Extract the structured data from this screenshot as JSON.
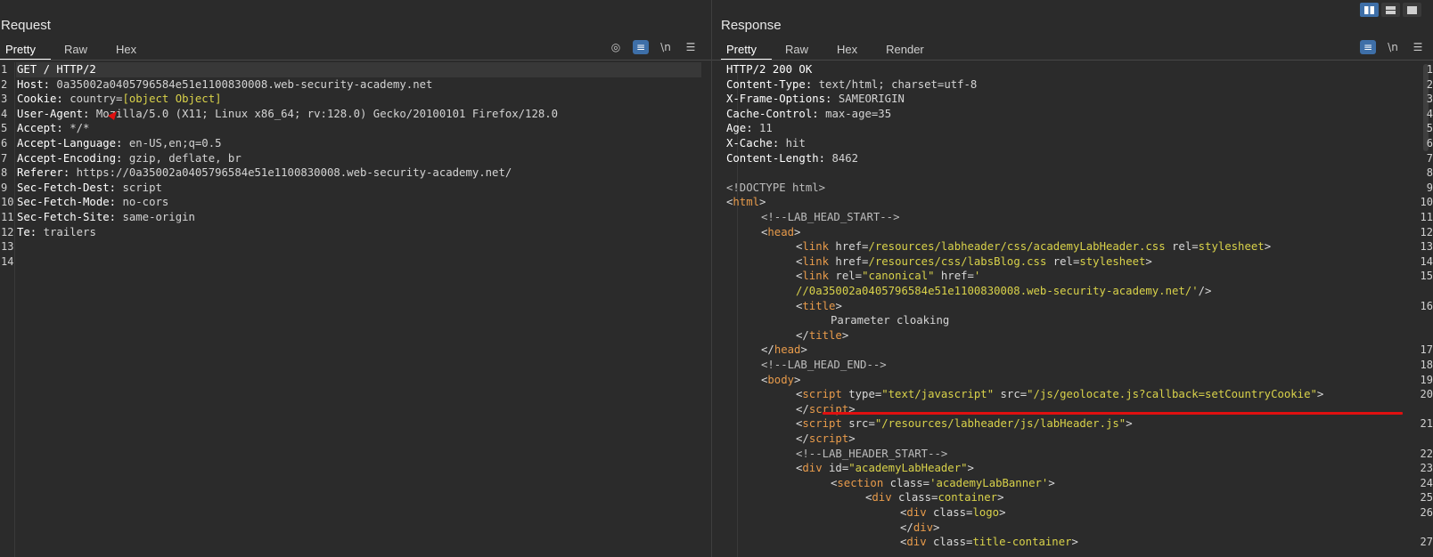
{
  "request": {
    "title": "Request",
    "tabs": [
      "Pretty",
      "Raw",
      "Hex"
    ],
    "tools": [
      {
        "name": "eye-off-icon",
        "glyph": "◎",
        "on": false
      },
      {
        "name": "wrap-lines-icon",
        "glyph": "≡",
        "on": true
      },
      {
        "name": "newline-toggle",
        "glyph": "\\n",
        "on": false
      },
      {
        "name": "menu-icon",
        "glyph": "☰",
        "on": false
      }
    ],
    "lines": [
      [
        [
          "k",
          "GET / HTTP/2"
        ]
      ],
      [
        [
          "k",
          "Host: "
        ],
        [
          "v",
          "0a35002a0405796584e51e1100830008.web-security-academy.net"
        ]
      ],
      [
        [
          "k",
          "Cookie: "
        ],
        [
          "v",
          "country="
        ],
        [
          "y",
          "[object Object]"
        ]
      ],
      [
        [
          "k",
          "User-Agent: "
        ],
        [
          "v",
          "Mozilla/5.0 (X11; Linux x86_64; rv:128.0) Gecko/20100101 Firefox/128.0"
        ]
      ],
      [
        [
          "k",
          "Accept: "
        ],
        [
          "v",
          "*/*"
        ]
      ],
      [
        [
          "k",
          "Accept-Language: "
        ],
        [
          "v",
          "en-US,en;q=0.5"
        ]
      ],
      [
        [
          "k",
          "Accept-Encoding: "
        ],
        [
          "v",
          "gzip, deflate, br"
        ]
      ],
      [
        [
          "k",
          "Referer: "
        ],
        [
          "v",
          "https://0a35002a0405796584e51e1100830008.web-security-academy.net/"
        ]
      ],
      [
        [
          "k",
          "Sec-Fetch-Dest: "
        ],
        [
          "v",
          "script"
        ]
      ],
      [
        [
          "k",
          "Sec-Fetch-Mode: "
        ],
        [
          "v",
          "no-cors"
        ]
      ],
      [
        [
          "k",
          "Sec-Fetch-Site: "
        ],
        [
          "v",
          "same-origin"
        ]
      ],
      [
        [
          "k",
          "Te: "
        ],
        [
          "v",
          "trailers"
        ]
      ],
      [],
      []
    ],
    "line_numbers": [
      "1",
      "2",
      "3",
      "4",
      "5",
      "6",
      "7",
      "8",
      "9",
      "10",
      "11",
      "12",
      "13",
      "14"
    ]
  },
  "response": {
    "title": "Response",
    "tabs": [
      "Pretty",
      "Raw",
      "Hex",
      "Render"
    ],
    "tools": [
      {
        "name": "wrap-lines-icon",
        "glyph": "≡",
        "on": true
      },
      {
        "name": "newline-toggle",
        "glyph": "\\n",
        "on": false
      },
      {
        "name": "menu-icon",
        "glyph": "☰",
        "on": false
      }
    ],
    "rows": [
      {
        "n": "1",
        "i": 0,
        "s": [
          [
            "k",
            "HTTP/2 200 OK"
          ]
        ]
      },
      {
        "n": "2",
        "i": 0,
        "s": [
          [
            "k",
            "Content-Type: "
          ],
          [
            "v",
            "text/html; charset=utf-8"
          ]
        ]
      },
      {
        "n": "3",
        "i": 0,
        "s": [
          [
            "k",
            "X-Frame-Options: "
          ],
          [
            "v",
            "SAMEORIGIN"
          ]
        ]
      },
      {
        "n": "4",
        "i": 0,
        "s": [
          [
            "k",
            "Cache-Control: "
          ],
          [
            "v",
            "max-age=35"
          ]
        ]
      },
      {
        "n": "5",
        "i": 0,
        "s": [
          [
            "k",
            "Age: "
          ],
          [
            "v",
            "11"
          ]
        ]
      },
      {
        "n": "6",
        "i": 0,
        "s": [
          [
            "k",
            "X-Cache: "
          ],
          [
            "v",
            "hit"
          ]
        ]
      },
      {
        "n": "7",
        "i": 0,
        "s": [
          [
            "k",
            "Content-Length: "
          ],
          [
            "v",
            "8462"
          ]
        ]
      },
      {
        "n": "8",
        "i": 0,
        "s": []
      },
      {
        "n": "9",
        "i": 0,
        "s": [
          [
            "c",
            "<!DOCTYPE html>"
          ]
        ]
      },
      {
        "n": "10",
        "i": 0,
        "s": [
          [
            "a",
            "<"
          ],
          [
            "t",
            "html"
          ],
          [
            "a",
            ">"
          ]
        ]
      },
      {
        "n": "11",
        "i": 1,
        "s": [
          [
            "c",
            "<!--LAB_HEAD_START-->"
          ]
        ]
      },
      {
        "n": "12",
        "i": 1,
        "s": [
          [
            "a",
            "<"
          ],
          [
            "t",
            "head"
          ],
          [
            "a",
            ">"
          ]
        ]
      },
      {
        "n": "13",
        "i": 2,
        "s": [
          [
            "a",
            "<"
          ],
          [
            "t",
            "link"
          ],
          [
            "a",
            " href="
          ],
          [
            "s",
            "/resources/labheader/css/academyLabHeader.css"
          ],
          [
            "a",
            " rel="
          ],
          [
            "s",
            "stylesheet"
          ],
          [
            "a",
            ">"
          ]
        ]
      },
      {
        "n": "14",
        "i": 2,
        "s": [
          [
            "a",
            "<"
          ],
          [
            "t",
            "link"
          ],
          [
            "a",
            " href="
          ],
          [
            "s",
            "/resources/css/labsBlog.css"
          ],
          [
            "a",
            " rel="
          ],
          [
            "s",
            "stylesheet"
          ],
          [
            "a",
            ">"
          ]
        ]
      },
      {
        "n": "15",
        "i": 2,
        "s": [
          [
            "a",
            "<"
          ],
          [
            "t",
            "link"
          ],
          [
            "a",
            " rel="
          ],
          [
            "s",
            "\"canonical\""
          ],
          [
            "a",
            " href="
          ],
          [
            "s",
            "'"
          ]
        ]
      },
      {
        "n": "",
        "i": 2,
        "s": [
          [
            "s",
            "//0a35002a0405796584e51e1100830008.web-security-academy.net/'"
          ],
          [
            "a",
            "/>"
          ]
        ]
      },
      {
        "n": "16",
        "i": 2,
        "s": [
          [
            "a",
            "<"
          ],
          [
            "t",
            "title"
          ],
          [
            "a",
            ">"
          ]
        ]
      },
      {
        "n": "",
        "i": 3,
        "s": [
          [
            "v",
            "Parameter cloaking"
          ]
        ]
      },
      {
        "n": "",
        "i": 2,
        "s": [
          [
            "a",
            "</"
          ],
          [
            "t",
            "title"
          ],
          [
            "a",
            ">"
          ]
        ]
      },
      {
        "n": "17",
        "i": 1,
        "s": [
          [
            "a",
            "</"
          ],
          [
            "t",
            "head"
          ],
          [
            "a",
            ">"
          ]
        ]
      },
      {
        "n": "18",
        "i": 1,
        "s": [
          [
            "c",
            "<!--LAB_HEAD_END-->"
          ]
        ]
      },
      {
        "n": "19",
        "i": 1,
        "s": [
          [
            "a",
            "<"
          ],
          [
            "t",
            "body"
          ],
          [
            "a",
            ">"
          ]
        ]
      },
      {
        "n": "20",
        "i": 2,
        "s": [
          [
            "a",
            "<"
          ],
          [
            "t",
            "script"
          ],
          [
            "a",
            " type="
          ],
          [
            "s",
            "\"text/javascript\""
          ],
          [
            "a",
            " src="
          ],
          [
            "s",
            "\"/js/geolocate.js?callback=setCountryCookie\""
          ],
          [
            "a",
            ">"
          ]
        ]
      },
      {
        "n": "",
        "i": 2,
        "s": [
          [
            "a",
            "</"
          ],
          [
            "t",
            "script"
          ],
          [
            "a",
            ">"
          ]
        ]
      },
      {
        "n": "21",
        "i": 2,
        "s": [
          [
            "a",
            "<"
          ],
          [
            "t",
            "script"
          ],
          [
            "a",
            " src="
          ],
          [
            "s",
            "\"/resources/labheader/js/labHeader.js\""
          ],
          [
            "a",
            ">"
          ]
        ]
      },
      {
        "n": "",
        "i": 2,
        "s": [
          [
            "a",
            "</"
          ],
          [
            "t",
            "script"
          ],
          [
            "a",
            ">"
          ]
        ]
      },
      {
        "n": "22",
        "i": 2,
        "s": [
          [
            "c",
            "<!--LAB_HEADER_START-->"
          ]
        ]
      },
      {
        "n": "23",
        "i": 2,
        "s": [
          [
            "a",
            "<"
          ],
          [
            "t",
            "div"
          ],
          [
            "a",
            " id="
          ],
          [
            "s",
            "\"academyLabHeader\""
          ],
          [
            "a",
            ">"
          ]
        ]
      },
      {
        "n": "24",
        "i": 3,
        "s": [
          [
            "a",
            "<"
          ],
          [
            "t",
            "section"
          ],
          [
            "a",
            " class="
          ],
          [
            "s",
            "'academyLabBanner'"
          ],
          [
            "a",
            ">"
          ]
        ]
      },
      {
        "n": "25",
        "i": 4,
        "s": [
          [
            "a",
            "<"
          ],
          [
            "t",
            "div"
          ],
          [
            "a",
            " class="
          ],
          [
            "s",
            "container"
          ],
          [
            "a",
            ">"
          ]
        ]
      },
      {
        "n": "26",
        "i": 5,
        "s": [
          [
            "a",
            "<"
          ],
          [
            "t",
            "div"
          ],
          [
            "a",
            " class="
          ],
          [
            "s",
            "logo"
          ],
          [
            "a",
            ">"
          ]
        ]
      },
      {
        "n": "",
        "i": 5,
        "s": [
          [
            "a",
            "</"
          ],
          [
            "t",
            "div"
          ],
          [
            "a",
            ">"
          ]
        ]
      },
      {
        "n": "27",
        "i": 5,
        "s": [
          [
            "a",
            "<"
          ],
          [
            "t",
            "div"
          ],
          [
            "a",
            " class="
          ],
          [
            "s",
            "title-container"
          ],
          [
            "a",
            ">"
          ]
        ]
      }
    ]
  },
  "layout_buttons": [
    {
      "name": "split-vertical-layout-button",
      "on": true
    },
    {
      "name": "split-horizontal-layout-button",
      "on": false
    },
    {
      "name": "single-tab-layout-button",
      "on": false
    }
  ]
}
